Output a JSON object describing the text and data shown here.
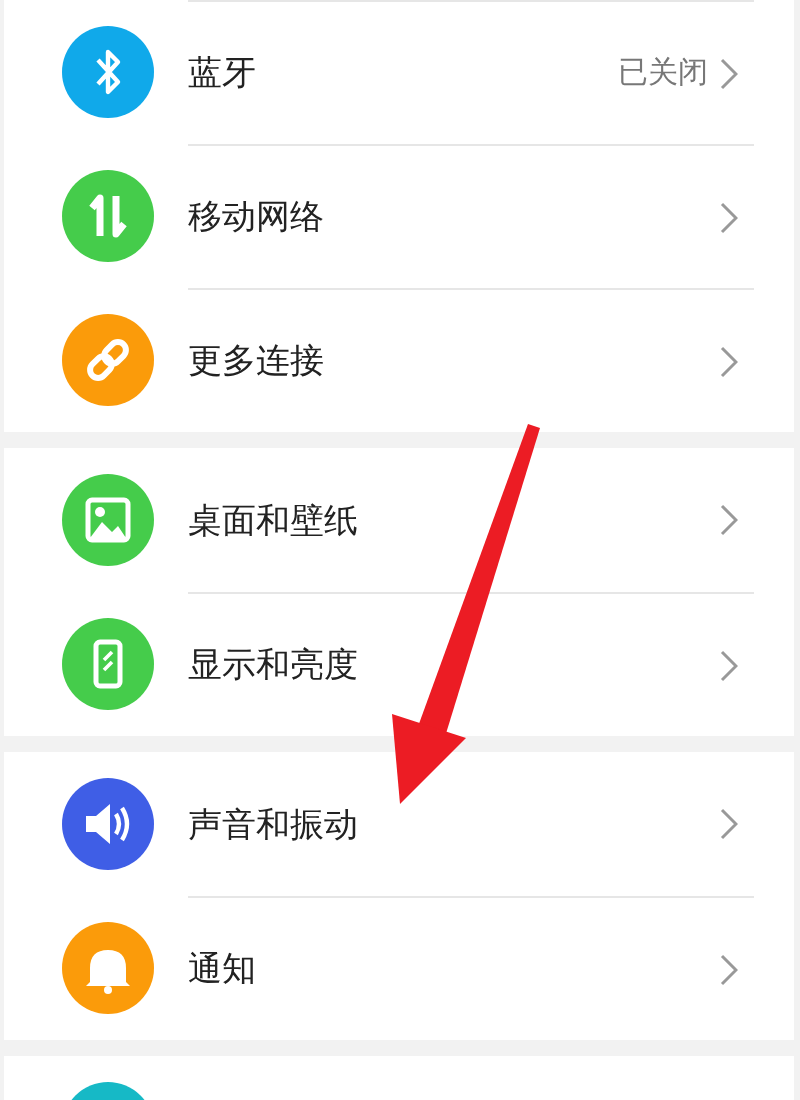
{
  "groups": [
    {
      "items": [
        {
          "label": "蓝牙",
          "value": "已关闭",
          "color": "#10a9ea"
        },
        {
          "label": "移动网络",
          "color": "#45cc4b"
        },
        {
          "label": "更多连接",
          "color": "#fb9b0a"
        }
      ]
    },
    {
      "items": [
        {
          "label": "桌面和壁纸",
          "color": "#45cc4b"
        },
        {
          "label": "显示和亮度",
          "color": "#45cc4b"
        }
      ]
    },
    {
      "items": [
        {
          "label": "声音和振动",
          "color": "#3f5ee6"
        },
        {
          "label": "通知",
          "color": "#fb9b0a"
        }
      ]
    },
    {
      "items": [
        {
          "color": "#16b9c6"
        }
      ]
    }
  ]
}
